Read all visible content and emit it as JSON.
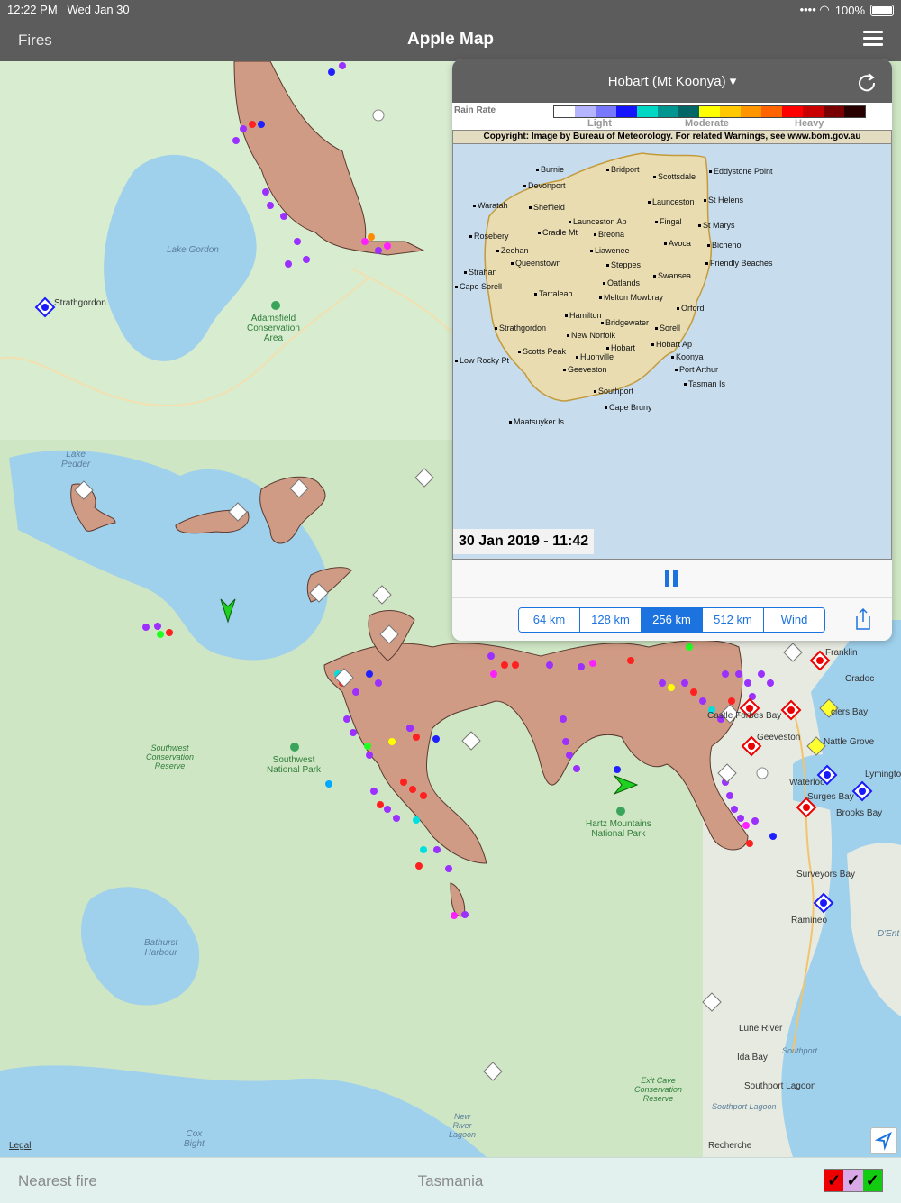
{
  "status": {
    "time": "12:22 PM",
    "date": "Wed Jan 30",
    "battery": "100%"
  },
  "nav": {
    "left": "Fires",
    "title": "Apple Map",
    "menu_icon": "hamburger-menu-icon"
  },
  "map": {
    "legal": "Legal",
    "labels": {
      "lake_gordon": "Lake\nGordon",
      "strathgordon": "Strathgordon",
      "adamsfield": "Adamsfield\nConservation\nArea",
      "lake_pedder": "Lake\nPedder",
      "southwest_cr": "Southwest\nConservation\nReserve",
      "southwest_np": "Southwest\nNational Park",
      "hartz": "Hartz Mountains\nNational Park",
      "bathurst": "Bathurst\nHarbour",
      "cox_bight": "Cox\nBight",
      "new_river": "New\nRiver\nLagoon",
      "exit_cave": "Exit Cave\nConservation\nReserve",
      "southport_lagoon_water": "Southport Lagoon",
      "southport_lagoon": "Southport Lagoon",
      "southport_water": "Southport",
      "lune_river": "Lune River",
      "ida_bay": "Ida Bay",
      "recherche": "Recherche",
      "franklin": "Franklin",
      "cradoc": "Cradoc",
      "cygnet_ishbay": "ciers Bay",
      "geeveston": "Geeveston",
      "castle_forbes": "Castle Forbes Bay",
      "huonville_grove": "Nattle Grove",
      "waterloo": "Waterloo",
      "surges_bay": "Surges Bay",
      "brooks_bay": "Brooks Bay",
      "lymington": "Lymington",
      "surveyors_bay": "Surveyors Bay",
      "ramineo": "Ramineo",
      "dent": "D'Ent"
    }
  },
  "radar": {
    "location": "Hobart (Mt Koonya) ▾",
    "rain_rate": "Rain Rate",
    "scale_labels": {
      "light": "Light",
      "moderate": "Moderate",
      "heavy": "Heavy"
    },
    "scale_colors": [
      "#ffffff",
      "#b4b4ff",
      "#7878ff",
      "#1414ff",
      "#00d8c3",
      "#009690",
      "#006666",
      "#ffff00",
      "#ffc800",
      "#ff9600",
      "#ff6400",
      "#ff0000",
      "#c80000",
      "#780000",
      "#280000"
    ],
    "copyright": "Copyright: Image by Bureau of Meteorology. For related Warnings, see www.bom.gov.au",
    "places": [
      "Burnie",
      "Bridport",
      "Eddystone Point",
      "Scottsdale",
      "Devonport",
      "St Helens",
      "Launceston",
      "Waratah",
      "Sheffield",
      "Launceston Ap",
      "Fingal",
      "St Marys",
      "Cradle Mt",
      "Breona",
      "Rosebery",
      "Bicheno",
      "Avoca",
      "Zeehan",
      "Liawenee",
      "Queenstown",
      "Steppes",
      "Friendly Beaches",
      "Strahan",
      "Swansea",
      "Cape Sorell",
      "Oatlands",
      "Tarraleah",
      "Melton Mowbray",
      "Orford",
      "Hamilton",
      "Strathgordon",
      "Bridgewater",
      "Sorell",
      "New Norfolk",
      "Hobart",
      "Hobart Ap",
      "Scotts Peak",
      "Huonville",
      "Koonya",
      "Low Rocky Pt",
      "Geeveston",
      "Port Arthur",
      "Tasman Is",
      "Southport",
      "Cape Bruny",
      "Maatsuyker Is"
    ],
    "timestamp": "30 Jan 2019 - 11:42",
    "ranges": [
      "64 km",
      "128 km",
      "256 km",
      "512 km",
      "Wind"
    ],
    "selected_range": "256 km"
  },
  "bottom": {
    "nearest": "Nearest fire",
    "region": "Tasmania",
    "checks": [
      "✓",
      "✓",
      "✓"
    ],
    "check_colors": [
      "#ee0000",
      "#d9a8e6",
      "#11cc11"
    ]
  }
}
